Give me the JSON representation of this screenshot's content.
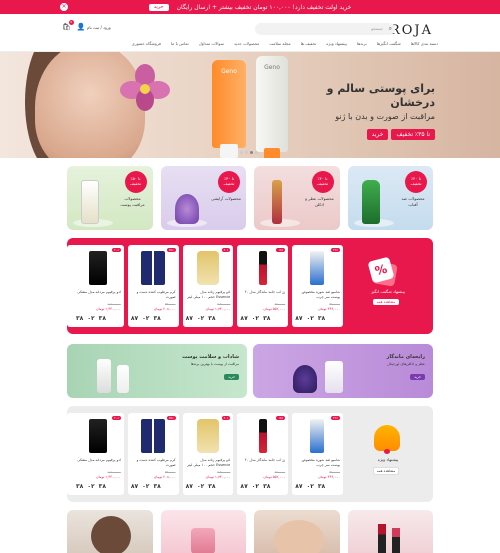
{
  "topbar": {
    "text": "خرید اولت تخفیف دارد! ۱۰۰,۰۰۰ تومان تخفیف بیشتر + ارسال رایگان",
    "button": "خرید",
    "close": "×"
  },
  "header": {
    "logo": "ROJA",
    "search_placeholder": "جستجو",
    "login": "ورود / ثبت نام",
    "cart_count": "0",
    "nav": [
      "دسته بندی کالاها",
      "شگفت انگیزها",
      "برندها",
      "پیشنهاد ویژه",
      "تخفیف ها",
      "مجله سلامت",
      "محصولات جدید",
      "سوالات متداول",
      "تماس با ما",
      "ارتباط با ما",
      "فروشگاه حضوری"
    ]
  },
  "hero": {
    "title": "برای پوستی سالم و درخشان",
    "subtitle": "مراقبت از صورت و بدن با ژنو",
    "discount": "تا ۳۵٪ تخفیف",
    "cta": "خرید",
    "brand1": "Geno",
    "brand2": "Geno"
  },
  "promos": [
    {
      "badge": "تا ۴۰٪ تخفیف",
      "label": "محصولات ضد آفتاب"
    },
    {
      "badge": "تا ۳۰٪ تخفیف",
      "label": "محصولات آرایشی"
    },
    {
      "badge": "تا ۴۰٪ تخفیف",
      "label": "محصولات عطر و ادکلن"
    },
    {
      "badge": "تا ۵۰٪ تخفیف",
      "label": "محصولات مراقبت پوست"
    }
  ],
  "deal1": {
    "title": "پیشنهاد شگفت انگیز",
    "button": "مشاهده همه",
    "products": [
      {
        "discount": "۲۳٪",
        "name": "شامپو ضد شوره مخصوص پوست سر چرب",
        "old": "۴۸۰,۰۰۰",
        "price": "۳۶۹,۰۰۰ تومان",
        "t": [
          "۳۸",
          "۰۲",
          "۸۷"
        ]
      },
      {
        "discount": "۱۵٪",
        "name": "رژ لب جامد ماندگار مدل ۲۰",
        "old": "۶۵۰,۰۰۰",
        "price": "۵۵۲,۰۰۰ تومان",
        "t": [
          "۳۸",
          "۰۲",
          "۸۷"
        ]
      },
      {
        "discount": "۴۰٪",
        "name": "ادو پرفیوم زنانه مدل Essence حجم ۱۰۰ میلی لیتر",
        "old": "۲,۹۰۰,۰۰۰",
        "price": "۱,۷۴۰,۰۰۰ تومان",
        "t": [
          "۳۸",
          "۰۲",
          "۸۷"
        ]
      },
      {
        "discount": "۳۵٪",
        "name": "کرم مرطوب کننده دست و صورت",
        "old": "۳۲۰,۰۰۰",
        "price": "۲۰۸,۰۰۰ تومان",
        "t": [
          "۳۸",
          "۰۲",
          "۸۷"
        ]
      },
      {
        "discount": "۲۰٪",
        "name": "ادو پرفیوم مردانه مدل مشکی",
        "old": "۱,۸۰۰,۰۰۰",
        "price": "۱,۴۴۰,۰۰۰ تومان",
        "t": [
          "۳۸",
          "۰۲",
          "۳۸"
        ]
      }
    ]
  },
  "deal2": {
    "title": "پیشنهاد ویژه",
    "button": "مشاهده همه",
    "products": [
      {
        "discount": "۲۳٪",
        "name": "شامپو ضد شوره مخصوص پوست سر چرب",
        "old": "۴۸۰,۰۰۰",
        "price": "۳۶۹,۰۰۰ تومان",
        "t": [
          "۳۸",
          "۰۲",
          "۸۷"
        ]
      },
      {
        "discount": "۱۵٪",
        "name": "رژ لب جامد ماندگار مدل ۲۰",
        "old": "۶۵۰,۰۰۰",
        "price": "۵۵۲,۰۰۰ تومان",
        "t": [
          "۳۸",
          "۰۲",
          "۸۷"
        ]
      },
      {
        "discount": "۴۰٪",
        "name": "ادو پرفیوم زنانه مدل Essence حجم ۱۰۰ میلی لیتر",
        "old": "۲,۹۰۰,۰۰۰",
        "price": "۱,۷۴۰,۰۰۰ تومان",
        "t": [
          "۳۸",
          "۰۲",
          "۸۷"
        ]
      },
      {
        "discount": "۳۵٪",
        "name": "کرم مرطوب کننده دست و صورت",
        "old": "۳۲۰,۰۰۰",
        "price": "۲۰۸,۰۰۰ تومان",
        "t": [
          "۳۸",
          "۰۲",
          "۸۷"
        ]
      },
      {
        "discount": "۲۰٪",
        "name": "ادو پرفیوم مردانه مدل مشکی",
        "old": "۱,۸۰۰,۰۰۰",
        "price": "۱,۴۴۰,۰۰۰ تومان",
        "t": [
          "۳۸",
          "۰۲",
          "۳۸"
        ]
      }
    ]
  },
  "banners": [
    {
      "title": "شاداب و سلامت پوست",
      "subtitle": "مراقبت از پوست با بهترین برندها",
      "button": "خرید"
    },
    {
      "title": "رایحه‌ای ماندگار",
      "subtitle": "عطر و ادکلن‌های اورجینال",
      "button": "خرید"
    }
  ],
  "colors": {
    "accent": "#e8174c",
    "green": "#2b8a5a",
    "purple": "#7b3bb0"
  }
}
